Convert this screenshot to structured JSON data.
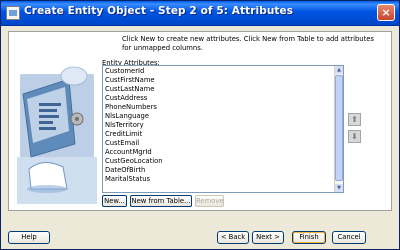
{
  "window": {
    "title": "Create Entity Object - Step 2 of 5: Attributes",
    "close_label": "×"
  },
  "instructions": "Click New to create new attributes.  Click New from Table to add attributes for unmapped columns.",
  "attributes": {
    "label": "Entity Attributes:",
    "items": [
      "CustomerId",
      "CustFirstName",
      "CustLastName",
      "CustAddress",
      "PhoneNumbers",
      "NlsLanguage",
      "NlsTerritory",
      "CreditLimit",
      "CustEmail",
      "AccountMgrId",
      "CustGeoLocation",
      "DateOfBirth",
      "MaritalStatus"
    ]
  },
  "list_buttons": {
    "new": "New...",
    "new_from_table": "New from Table...",
    "remove": "Remove"
  },
  "move": {
    "up": "⬆",
    "down": "⬇"
  },
  "footer": {
    "help": "Help",
    "back": "< Back",
    "next": "Next >",
    "finish": "Finish",
    "cancel": "Cancel"
  }
}
